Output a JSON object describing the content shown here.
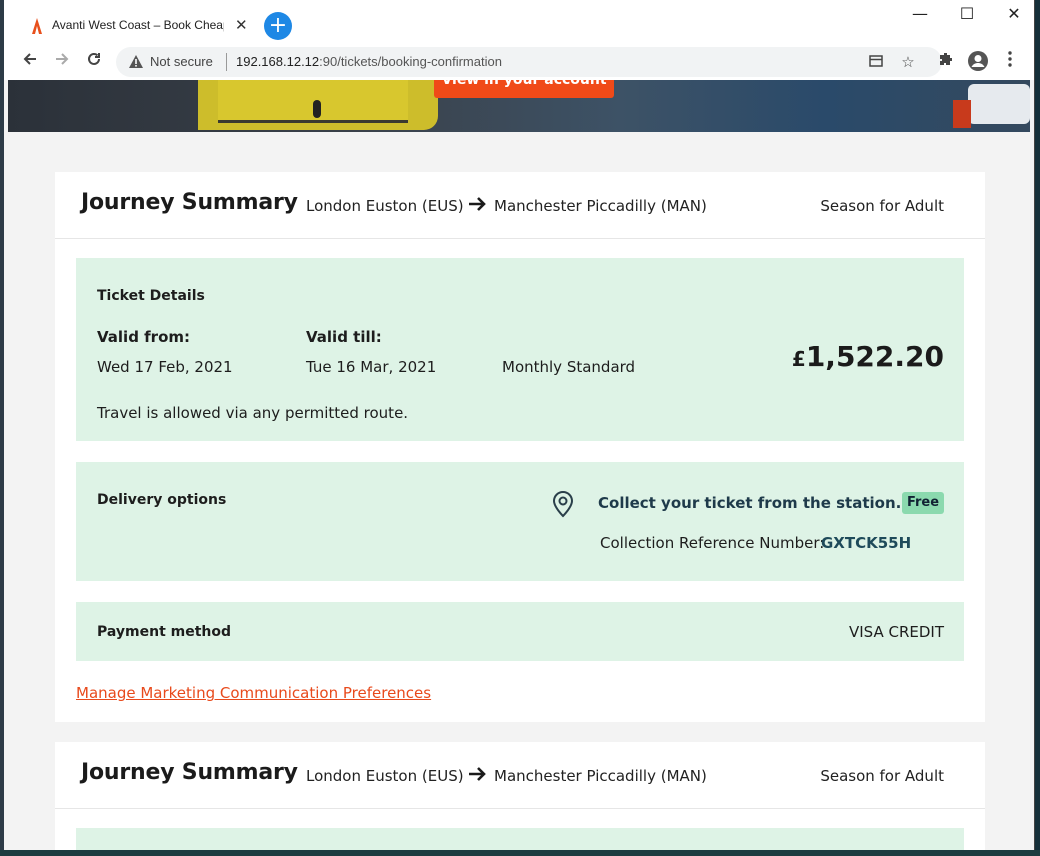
{
  "browser": {
    "tab_title": "Avanti West Coast – Book Cheap",
    "tab_close": "✕",
    "new_tab": "+",
    "not_secure": "Not secure",
    "url_host": "192.168.12.12",
    "url_rest": ":90/tickets/booking-confirmation",
    "window_controls": {
      "minimize": "—",
      "maximize": "☐",
      "close": "✕"
    },
    "colors": {
      "accent": "#1e88e5"
    }
  },
  "hero": {
    "button_label": "View in your account"
  },
  "journeys": [
    {
      "title": "Journey Summary",
      "from": "London Euston (EUS)",
      "to": "Manchester Piccadilly (MAN)",
      "ticket_type": "Season for Adult"
    },
    {
      "title": "Journey Summary",
      "from": "London Euston (EUS)",
      "to": "Manchester Piccadilly (MAN)",
      "ticket_type": "Season for Adult"
    }
  ],
  "ticket": {
    "heading": "Ticket Details",
    "valid_from_label": "Valid from:",
    "valid_from": "Wed 17 Feb, 2021",
    "valid_till_label": "Valid till:",
    "valid_till": "Tue 16 Mar, 2021",
    "fare": "Monthly Standard",
    "price_currency": "£",
    "price_amount": "1,522.20",
    "route_note": "Travel is allowed via any permitted route."
  },
  "delivery": {
    "heading": "Delivery options",
    "method": "Collect your ticket from the station.",
    "badge": "Free",
    "ref_label": "Collection Reference Number:",
    "ref_value": "GXTCK55H",
    "colors": {
      "badge": "#8bd9ae",
      "panel": "#def3e6"
    }
  },
  "payment": {
    "heading": "Payment method",
    "value": "VISA CREDIT"
  },
  "marketing_link": "Manage Marketing Communication Preferences",
  "colors": {
    "brand_orange": "#f04a18",
    "link": "#e84a1c"
  }
}
